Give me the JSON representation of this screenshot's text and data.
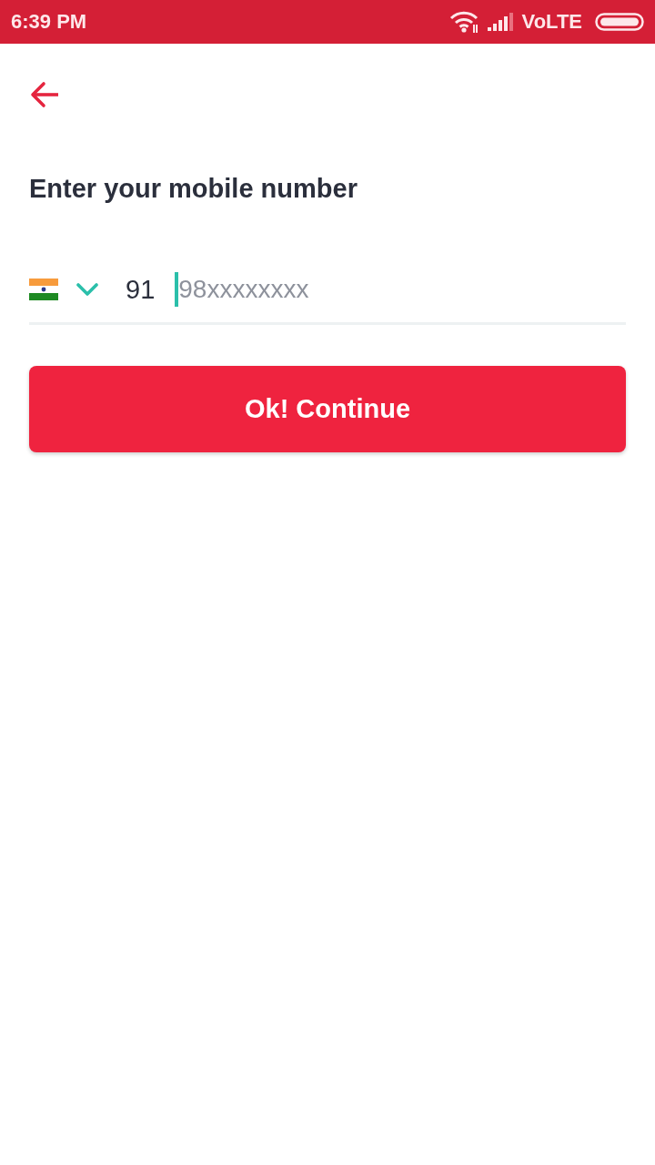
{
  "status_bar": {
    "time": "6:39 PM",
    "network_label": "VoLTE"
  },
  "title": "Enter your mobile number",
  "phone_field": {
    "country_code": "91",
    "placeholder": "98xxxxxxxx",
    "focused": true
  },
  "continue_button": {
    "label": "Ok! Continue"
  }
}
